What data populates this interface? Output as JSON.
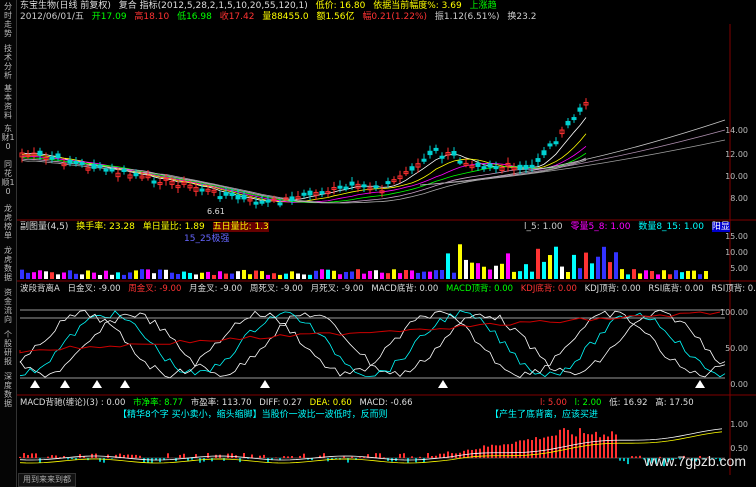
{
  "sidebar": {
    "tabs": [
      "分时走势",
      "技术分析",
      "基本资料",
      "东财10",
      "同花顺10",
      "龙虎榜单",
      "龙虎数据",
      "资金流向",
      "个股研报",
      "深度数据"
    ]
  },
  "main_header": {
    "name": "东宝生物(日线 前复权)",
    "mode": "复合 指标(2012,5,28,2,1,5,10,20,55,120,1)",
    "val1": "低价: 16.80",
    "val2": "依据当前幅度%: 3.69",
    "trend": "上涨趋"
  },
  "quote_row": {
    "date": "2012/06/01/五",
    "open": "开17.09",
    "high": "高18.10",
    "low": "低16.98",
    "close": "收17.42",
    "volume": "量88455.0",
    "amount": "额1.56亿",
    "change": "幅0.21(1.22%)",
    "amp": "振1.12(6.51%)",
    "turn": "换23.2"
  },
  "price_axis": [
    "14.00",
    "12.00",
    "10.00",
    "8.00"
  ],
  "price_labels": {
    "low": "6.61"
  },
  "vol_header": {
    "title": "副图量(4,5)",
    "turnover": "换手率: 23.28",
    "ratio": "单日量比: 1.89",
    "five_day": "五日量比: 1.3",
    "l5": "l_5: 1.00",
    "zero": "零量5_8: 1.00",
    "count": "数量8_15: 1.00",
    "mark": "阳显",
    "sub": "15_25极强"
  },
  "vol_axis": [
    "15.00",
    "10.00",
    "5.00"
  ],
  "kdj_header": {
    "title": "波段背离A",
    "golden_day": "日金叉: -9.00",
    "dead_day": "周金叉: -9.00",
    "golden_month": "月金叉: -9.00",
    "dead_week": "周死叉: -9.00",
    "dead_month": "月死叉: -9.00",
    "macd_bottom": "MACD底背: 0.00",
    "macd_top": "MACD顶背: 0.00",
    "kdj_bottom": "KDJ底背: 0.00",
    "kdj_top": "KDJ顶背: 0.00",
    "rsi_bottom": "RSI底背: 0.00",
    "rsi_top": "RSI顶背: 0.00"
  },
  "kdj_axis": [
    "100.00",
    "50.00",
    "0.00"
  ],
  "macd_header": {
    "title": "MACD背驰(缠论)(3) : 0.00",
    "net": "市净率: 8.77",
    "pe": "市盈率: 113.70",
    "diff": "DIFF: 0.27",
    "dea": "DEA: 0.60",
    "macd": "MACD: -0.66",
    "v1": "l: 5.00",
    "v2": "l: 2.00",
    "low": "低: 16.92",
    "high": "高: 17.50"
  },
  "macd_text": {
    "hint": "【精华8个字 买小卖小，缩头缩脚】当股价一波比一波低时，反而则",
    "signal": "【产生了底背离，应该买进"
  },
  "macd_axis": [
    "1.00",
    "0.50"
  ],
  "watermark": "www.7gpzb.com",
  "bottom_tab": "用到来来到都"
}
